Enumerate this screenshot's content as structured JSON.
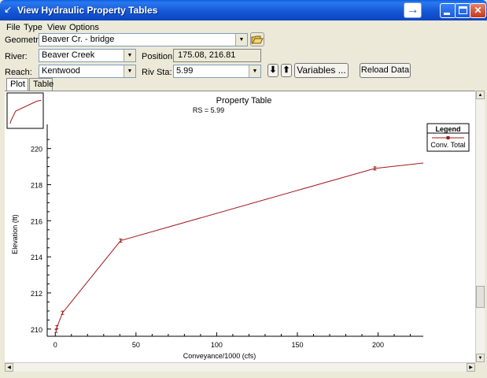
{
  "window": {
    "title": "View Hydraulic Property Tables",
    "app_icon": "hecras-icon",
    "controls": {
      "forward": "arrow-right-icon",
      "minimize": "minimize-icon",
      "maximize": "maximize-icon",
      "close": "close-icon"
    }
  },
  "menu": [
    "File",
    "Type",
    "View",
    "Options"
  ],
  "form": {
    "geometry_label": "Geometry:",
    "geometry_value": "Beaver Cr.  - bridge",
    "river_label": "River:",
    "river_value": "Beaver Creek",
    "position_label": "Position:",
    "position_value": "175.08, 216.81",
    "reach_label": "Reach:",
    "reach_value": "Kentwood",
    "riv_sta_label": "Riv Sta:",
    "riv_sta_value": "5.99",
    "variables_button": "Variables ...",
    "reload_button": "Reload Data",
    "open_icon": "folder-open-icon",
    "down_icon": "arrow-down-icon",
    "up_icon": "arrow-up-icon"
  },
  "tabs": [
    {
      "label": "Plot",
      "active": true
    },
    {
      "label": "Table",
      "active": false
    }
  ],
  "chart_data": {
    "type": "line",
    "title": "Property Table",
    "subtitle": "RS = 5.99",
    "xlabel": "Conveyance/1000 (cfs)",
    "ylabel": "Elevation (ft)",
    "xlim": [
      -5,
      228
    ],
    "ylim": [
      209.6,
      220.9
    ],
    "xticks": [
      0,
      50,
      100,
      150,
      200
    ],
    "yticks": [
      210,
      212,
      214,
      216,
      218,
      220
    ],
    "legend": {
      "title": "Legend",
      "position": "top-right"
    },
    "series": [
      {
        "name": "Conv. Total",
        "color": "#a01818",
        "points": [
          {
            "x": 0.5,
            "y": 209.9
          },
          {
            "x": 1.0,
            "y": 210.1
          },
          {
            "x": 4.5,
            "y": 210.9
          },
          {
            "x": 40.5,
            "y": 214.9
          },
          {
            "x": 198,
            "y": 218.9
          },
          {
            "x": 230,
            "y": 219.2
          }
        ]
      }
    ]
  }
}
